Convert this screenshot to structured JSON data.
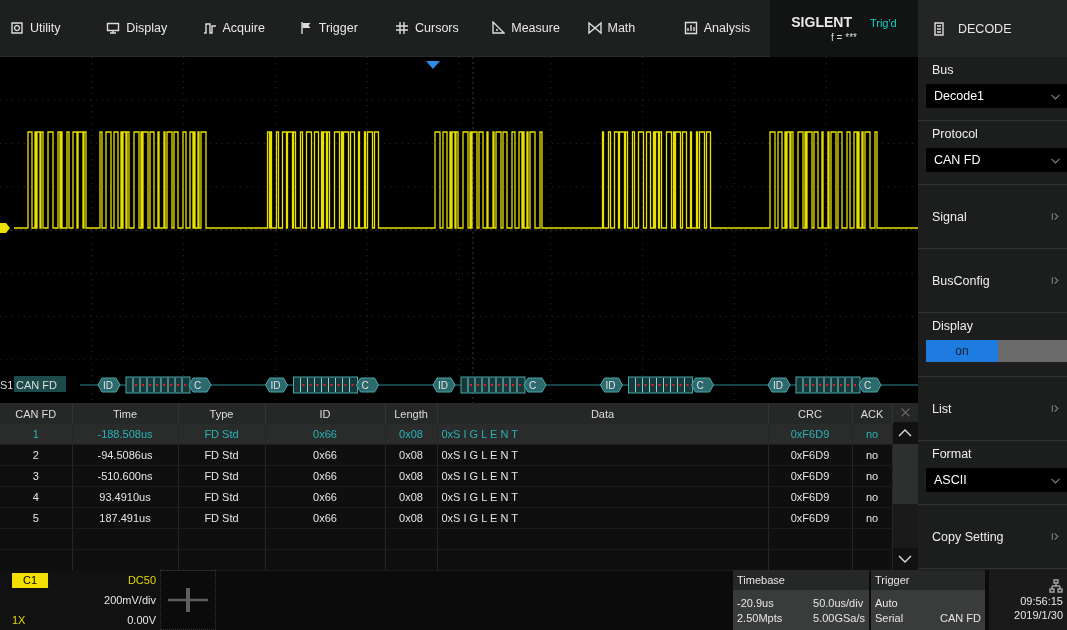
{
  "menu_bar": [
    {
      "label": "Utility",
      "kind": "gear"
    },
    {
      "label": "Display",
      "kind": "monitor"
    },
    {
      "label": "Acquire",
      "kind": "pulse"
    },
    {
      "label": "Trigger",
      "kind": "flag"
    },
    {
      "label": "Cursors",
      "kind": "hash"
    },
    {
      "label": "Measure",
      "kind": "ruler"
    },
    {
      "label": "Math",
      "kind": "math"
    },
    {
      "label": "Analysis",
      "kind": "chart"
    }
  ],
  "status": {
    "brand": "SIGLENT",
    "trigger_state": "Trig'd",
    "frequency": "f = ***"
  },
  "bus": {
    "source": "S1",
    "label": "CAN FD",
    "frames": [
      {
        "start": "ID",
        "end": "C"
      },
      {
        "start": "ID",
        "end": "C"
      },
      {
        "start": "ID",
        "end": "C"
      },
      {
        "start": "ID",
        "end": "C"
      },
      {
        "start": "ID",
        "end": "C"
      }
    ]
  },
  "table": {
    "columns": [
      "CAN FD",
      "Time",
      "Type",
      "ID",
      "Length",
      "Data",
      "CRC",
      "ACK"
    ],
    "rows": [
      {
        "selected": true,
        "cells": [
          "1",
          "-188.508us",
          "FD Std",
          "0x66",
          "0x08",
          "0xS I G L E N T",
          "0xF6D9",
          "no"
        ]
      },
      {
        "selected": false,
        "cells": [
          "2",
          "-94.5086us",
          "FD Std",
          "0x66",
          "0x08",
          "0xS I G L E N T",
          "0xF6D9",
          "no"
        ]
      },
      {
        "selected": false,
        "cells": [
          "3",
          "-510.600ns",
          "FD Std",
          "0x66",
          "0x08",
          "0xS I G L E N T",
          "0xF6D9",
          "no"
        ]
      },
      {
        "selected": false,
        "cells": [
          "4",
          "93.4910us",
          "FD Std",
          "0x66",
          "0x08",
          "0xS I G L E N T",
          "0xF6D9",
          "no"
        ]
      },
      {
        "selected": false,
        "cells": [
          "5",
          "187.491us",
          "FD Std",
          "0x66",
          "0x08",
          "0xS I G L E N T",
          "0xF6D9",
          "no"
        ]
      }
    ]
  },
  "side_menu": {
    "title": "DECODE",
    "items": [
      {
        "kind": "dropdown",
        "label": "Bus",
        "value": "Decode1"
      },
      {
        "kind": "dropdown",
        "label": "Protocol",
        "value": "CAN FD"
      },
      {
        "kind": "submenu",
        "label": "Signal"
      },
      {
        "kind": "submenu",
        "label": "BusConfig"
      },
      {
        "kind": "toggle",
        "label": "Display",
        "value": "on",
        "on": true
      },
      {
        "kind": "submenu",
        "label": "List"
      },
      {
        "kind": "dropdown",
        "label": "Format",
        "value": "ASCII"
      },
      {
        "kind": "submenu",
        "label": "Copy Setting"
      }
    ]
  },
  "channel": {
    "name": "C1",
    "coupling": "DC50",
    "scale": "200mV/div",
    "probe": "1X",
    "offset": "0.00V"
  },
  "timebase": {
    "title": "Timebase",
    "delay": "-20.9us",
    "scale": "50.0us/div",
    "memory": "2.50Mpts",
    "sample_rate": "5.00GSa/s"
  },
  "trigger": {
    "title": "Trigger",
    "mode": "Auto",
    "type": "Serial",
    "source": "CAN FD"
  },
  "clock": {
    "time": "09:56:15",
    "date": "2019/1/30"
  }
}
